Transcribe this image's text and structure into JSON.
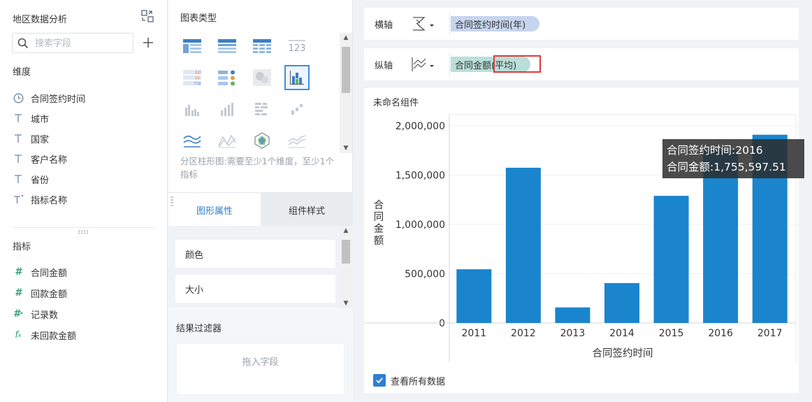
{
  "left_panel": {
    "title": "地区数据分析",
    "search_placeholder": "搜索字段",
    "dimensions_title": "维度",
    "dimensions": [
      {
        "label": "合同签约时间",
        "icon": "clock-icon"
      },
      {
        "label": "城市",
        "icon": "text-field-icon"
      },
      {
        "label": "国家",
        "icon": "text-field-icon"
      },
      {
        "label": "客户名称",
        "icon": "text-field-icon"
      },
      {
        "label": "省份",
        "icon": "text-field-icon"
      },
      {
        "label": "指标名称",
        "icon": "text-field-special-icon"
      }
    ],
    "measures_title": "指标",
    "measures": [
      {
        "label": "合同金额",
        "icon": "hash-icon"
      },
      {
        "label": "回款金额",
        "icon": "hash-icon"
      },
      {
        "label": "记录数",
        "icon": "hash-special-icon"
      },
      {
        "label": "未回款金额",
        "icon": "formula-icon"
      }
    ]
  },
  "middle_panel": {
    "chart_type_title": "图表类型",
    "chart_type_desc": "分区柱形图:需要至少1个维度，至少1个指标",
    "tabs": [
      "图形属性",
      "组件样式"
    ],
    "properties": [
      "颜色",
      "大小"
    ],
    "filter_title": "结果过滤器",
    "drop_zone_text": "拖入字段"
  },
  "axes": {
    "x_label": "横轴",
    "x_field": "合同签约时间(年)",
    "y_label": "纵轴",
    "y_field_name": "合同金额",
    "y_field_agg": "(平均)"
  },
  "component": {
    "title": "未命名组件",
    "show_all_label": "查看所有数据",
    "tooltip_line1": "合同签约时间:2016",
    "tooltip_line2": "合同金额:1,755,597.51"
  },
  "colors": {
    "bar": "#1a85cc",
    "accent": "#2f7fd4",
    "highlight_box": "#e03a3a"
  },
  "chart_data": {
    "type": "bar",
    "categories": [
      "2011",
      "2012",
      "2013",
      "2014",
      "2015",
      "2016",
      "2017"
    ],
    "values": [
      545000,
      1575000,
      158000,
      405000,
      1290000,
      1755597.51,
      1910000
    ],
    "xlabel": "合同签约时间",
    "ylabel": "合同金额",
    "ylim": [
      0,
      2000000
    ],
    "yticks": [
      "0",
      "500,000",
      "1,000,000",
      "1,500,000",
      "2,000,000"
    ],
    "ytick_values": [
      0,
      500000,
      1000000,
      1500000,
      2000000
    ],
    "grid": true
  }
}
